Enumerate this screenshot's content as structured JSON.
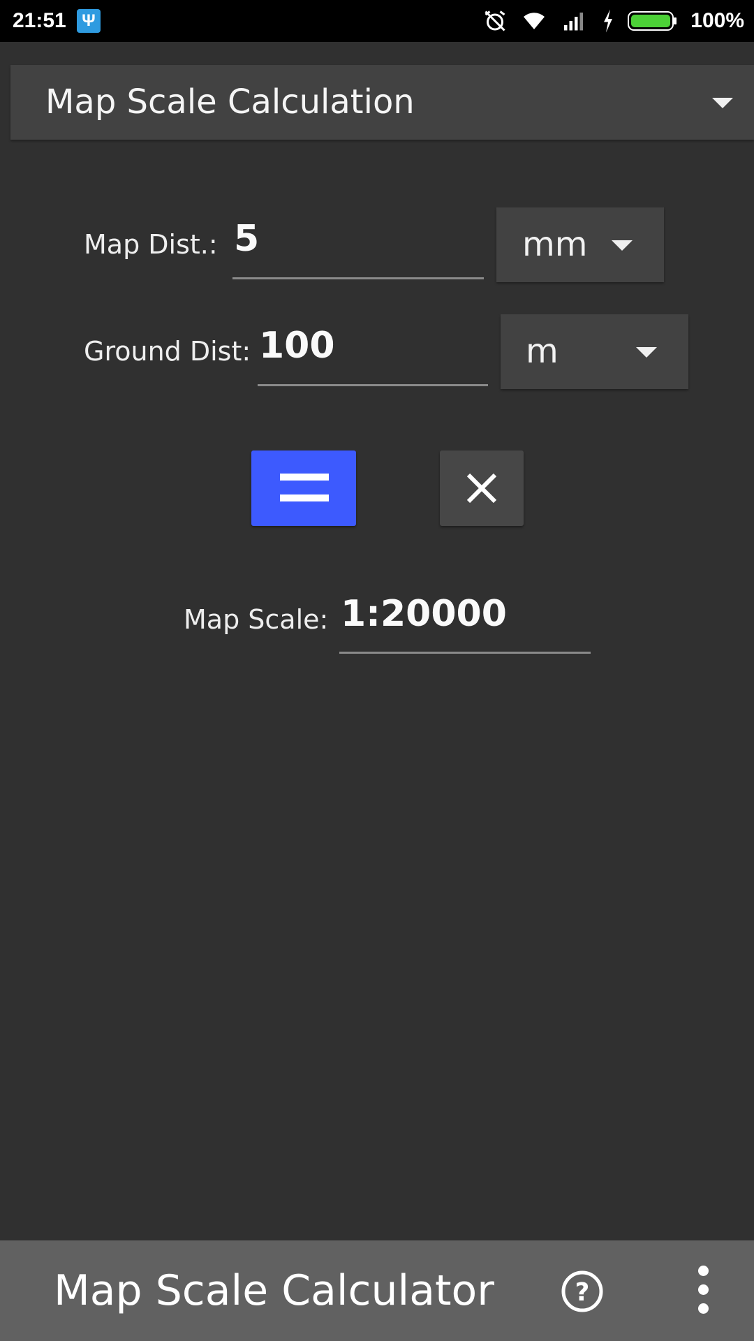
{
  "status_bar": {
    "time": "21:51",
    "usb_icon": "usb-icon",
    "battery": "100%",
    "icons": [
      "alarm-off-icon",
      "wifi-icon",
      "signal-icon",
      "charging-icon",
      "battery-icon"
    ]
  },
  "calc_type_spinner": {
    "selected": "Map Scale Calculation"
  },
  "map_distance": {
    "label": "Map Dist.:",
    "value": "5",
    "unit": "mm"
  },
  "ground_distance": {
    "label": "Ground Dist:",
    "value": "100",
    "unit": "m"
  },
  "buttons": {
    "calculate_icon": "equals-icon",
    "clear_icon": "close-icon"
  },
  "result": {
    "label": "Map Scale:",
    "value": "1:20000"
  },
  "app_bar": {
    "title": "Map Scale Calculator",
    "help_icon": "help-icon",
    "more_icon": "more-vert-icon"
  },
  "colors": {
    "background": "#303030",
    "accent": "#3d5afe",
    "app_bar": "#616161",
    "spinner": "#424242"
  }
}
